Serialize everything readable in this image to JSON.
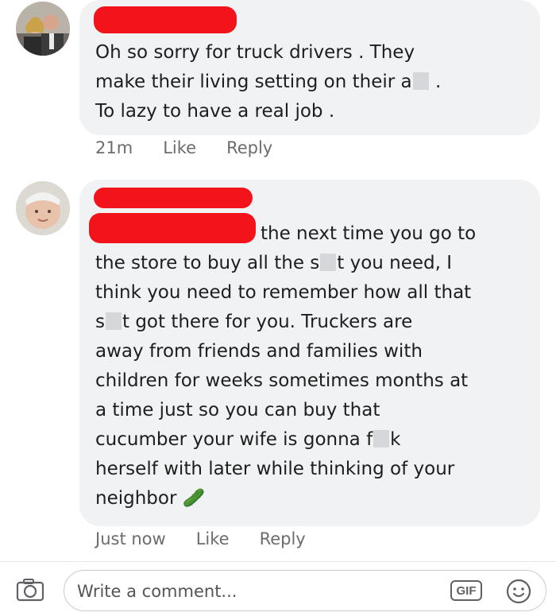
{
  "comments": [
    {
      "text": "Oh so sorry for truck drivers . They\nmake their living setting on their a",
      "text_tail": " .\nTo lazy to have a real job .",
      "time": "21m",
      "like_label": "Like",
      "reply_label": "Reply"
    },
    {
      "line1": "the next time you go to",
      "text_a": "the store to buy all the s",
      "text_b": "t you need, I\nthink you need to remember how all that\ns",
      "text_c": "t got there for you. Truckers are\naway from friends and families with\nchildren for weeks sometimes months at\na time just so you can buy that\ncucumber your wife is gonna f",
      "text_d": "k\nherself with later while thinking of your\nneighbor ",
      "emoji": "🥒",
      "time": "Just now",
      "like_label": "Like",
      "reply_label": "Reply"
    }
  ],
  "composer": {
    "placeholder": "Write a comment...",
    "gif_label": "GIF"
  },
  "colors": {
    "redaction": "#f2131b",
    "bubble": "#f1f2f4",
    "cucumber": "#5aa832"
  }
}
